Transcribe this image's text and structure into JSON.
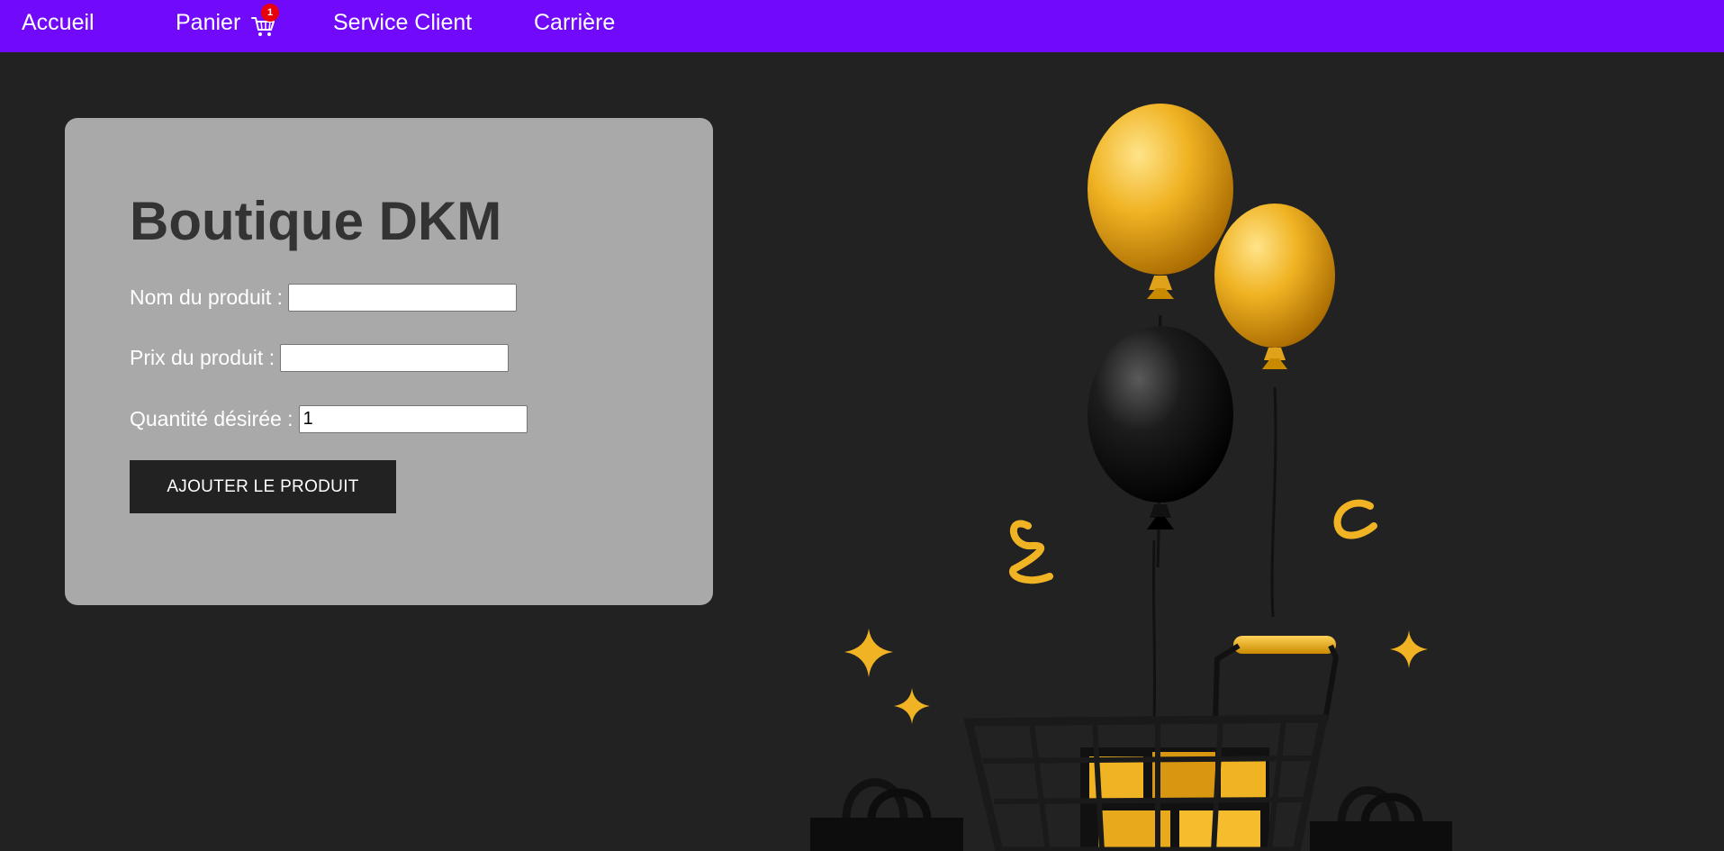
{
  "nav": {
    "items": [
      {
        "label": "Accueil"
      },
      {
        "label": "Panier"
      },
      {
        "label": "Service Client"
      },
      {
        "label": "Carrière"
      }
    ],
    "cart_badge": "1"
  },
  "form": {
    "title": "Boutique DKM",
    "fields": [
      {
        "label": "Nom du produit :",
        "value": ""
      },
      {
        "label": "Prix du produit :",
        "value": ""
      },
      {
        "label": "Quantité désirée :",
        "value": "1"
      }
    ],
    "submit_label": "AJOUTER LE PRODUIT"
  },
  "colors": {
    "navbar": "#7109fb",
    "background": "#222222",
    "card": "#a9a9a9",
    "badge": "#e8000b",
    "accent_gold": "#f0b323"
  },
  "icons": {
    "cart": "shopping-cart-icon"
  }
}
